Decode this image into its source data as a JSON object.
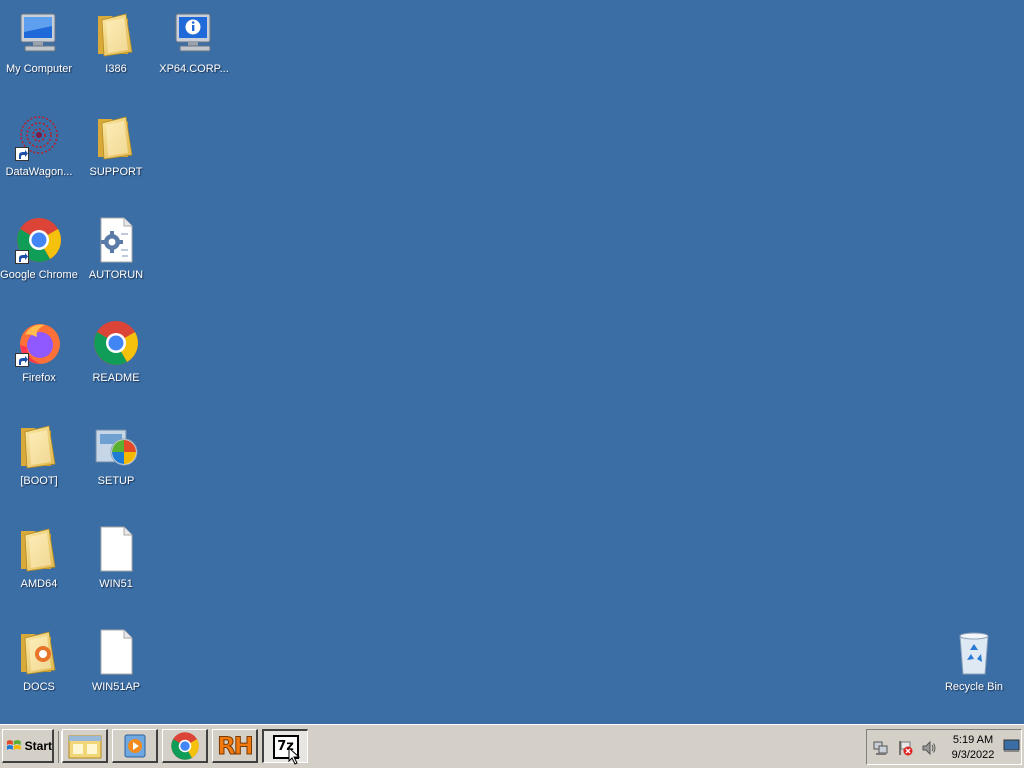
{
  "desktop": {
    "background_color": "#3a6ea5",
    "icons": {
      "my_computer": {
        "label": "My Computer",
        "icon": "computer-icon"
      },
      "i386": {
        "label": "I386",
        "icon": "folder-icon"
      },
      "xp64": {
        "label": "XP64.CORP...",
        "icon": "info-computer-icon"
      },
      "datawagon": {
        "label": "DataWagon...",
        "icon": "datawagon-icon"
      },
      "support": {
        "label": "SUPPORT",
        "icon": "folder-icon"
      },
      "chrome": {
        "label": "Google Chrome",
        "icon": "chrome-icon"
      },
      "autorun": {
        "label": "AUTORUN",
        "icon": "settings-file-icon"
      },
      "firefox": {
        "label": "Firefox",
        "icon": "firefox-icon"
      },
      "readme": {
        "label": "README",
        "icon": "chrome-icon"
      },
      "boot": {
        "label": "[BOOT]",
        "icon": "folder-icon"
      },
      "setup": {
        "label": "SETUP",
        "icon": "setup-icon"
      },
      "amd64": {
        "label": "AMD64",
        "icon": "folder-icon"
      },
      "win51": {
        "label": "WIN51",
        "icon": "blank-file-icon"
      },
      "docs": {
        "label": "DOCS",
        "icon": "folder-icon"
      },
      "win51ap": {
        "label": "WIN51AP",
        "icon": "blank-file-icon"
      },
      "recycle_bin": {
        "label": "Recycle Bin",
        "icon": "recycle-bin-icon"
      }
    }
  },
  "taskbar": {
    "start_label": "Start",
    "buttons": [
      "file-explorer-icon",
      "media-player-icon",
      "chrome-icon",
      "rh-icon",
      "7zip-icon"
    ],
    "rh_text": "RH",
    "sevenzip_text": "7z",
    "clock": {
      "time": "5:19 AM",
      "date": "9/3/2022"
    }
  }
}
